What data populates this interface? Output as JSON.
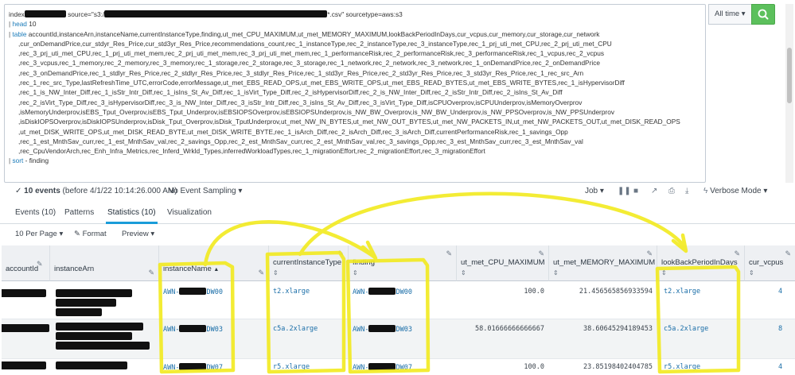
{
  "search": {
    "line1_prefix": "index",
    "line1_source": "source=\"s3:/",
    "line1_suffix": "*.csv\"",
    "line1_sourcetype": "sourcetype=aws:s3",
    "pipe": "|",
    "head_cmd": "head",
    "head_arg": "10",
    "table_cmd": "table",
    "table_lines": [
      "accountId,instanceArn,instanceName,currentInstanceType,finding,ut_met_CPU_MAXIMUM,ut_met_MEMORY_MAXIMUM,lookBackPeriodInDays,cur_vcpus,cur_memory,cur_storage,cur_network",
      ",cur_onDemandPrice,cur_stdyr_Res_Price,cur_std3yr_Res_Price,recommendations_count,rec_1_instanceType,rec_2_instanceType,rec_3_instanceType,rec_1_prj_uti_met_CPU,rec_2_prj_uti_met_CPU",
      ",rec_3_prj_uti_met_CPU,rec_1_prj_uti_met_mem,rec_2_prj_uti_met_mem,rec_3_prj_uti_met_mem,rec_1_performanceRisk,rec_2_performanceRisk,rec_3_performanceRisk,rec_1_vcpus,rec_2_vcpus",
      ",rec_3_vcpus,rec_1_memory,rec_2_memory,rec_3_memory,rec_1_storage,rec_2_storage,rec_3_storage,rec_1_network,rec_2_network,rec_3_network,rec_1_onDemandPrice,rec_2_onDemandPrice",
      ",rec_3_onDemandPrice,rec_1_stdlyr_Res_Price,rec_2_stdlyr_Res_Price,rec_3_stdlyr_Res_Price,rec_1_std3yr_Res_Price,rec_2_std3yr_Res_Price,rec_3_std3yr_Res_Price,rec_1_rec_src_Arn",
      ",rec_1_rec_src_Type,lastRefreshTime_UTC,errorCode,errorMessage,ut_met_EBS_READ_OPS,ut_met_EBS_WRITE_OPS,ut_met_EBS_READ_BYTES,ut_met_EBS_WRITE_BYTES,rec_1_isHypervisorDiff",
      ",rec_1_is_NW_Inter_Diff,rec_1_isStr_Intr_Diff,rec_1_isIns_St_Av_Diff,rec_1_isVirt_Type_Diff,rec_2_isHypervisorDiff,rec_2_is_NW_Inter_Diff,rec_2_isStr_Intr_Diff,rec_2_isIns_St_Av_Diff",
      ",rec_2_isVirt_Type_Diff,rec_3_isHypervisorDiff,rec_3_is_NW_Inter_Diff,rec_3_isStr_Intr_Diff,rec_3_isIns_St_Av_Diff,rec_3_isVirt_Type_Diff,isCPUOverprov,isCPUUnderprov,isMemoryOverprov",
      ",isMemoryUnderprov,isEBS_Tput_Overprov,isEBS_Tput_Underprov,isEBSIOPSOverprov,isEBSIOPSUnderprov,is_NW_BW_Overprov,is_NW_BW_Underprov,is_NW_PPSOverprov,is_NW_PPSUnderprov",
      ",isDiskIOPSOverprov,isDiskIOPSUnderprov,isDisk_Tput_Overprov,isDisk_TputUnderprov,ut_met_NW_IN_BYTES,ut_met_NW_OUT_BYTES,ut_met_NW_PACKETS_IN,ut_met_NW_PACKETS_OUT,ut_met_DISK_READ_OPS",
      ",ut_met_DISK_WRITE_OPS,ut_met_DISK_READ_BYTE,ut_met_DISK_WRITE_BYTE,rec_1_isArch_Diff,rec_2_isArch_Diff,rec_3_isArch_Diff,currentPerformanceRisk,rec_1_savings_Opp",
      ",rec_1_est_MnthSav_curr,rec_1_est_MnthSav_val,rec_2_savings_Opp,rec_2_est_MnthSav_curr,rec_2_est_MnthSav_val,rec_3_savings_Opp,rec_3_est_MnthSav_curr,rec_3_est_MnthSav_val",
      ",rec_CpuVendorArch,rec_Enh_Infra_Metrics,rec_Inferd_Wrkld_Types,inferredWorkloadTypes,rec_1_migrationEffort,rec_2_migrationEffort,rec_3_migrationEffort"
    ],
    "sort_cmd": "sort",
    "sort_arg": "- finding",
    "time_range": "All time ▾",
    "search_icon": "search-icon"
  },
  "status": {
    "count": "10 events",
    "detail": "(before 4/1/22 10:14:26.000 AM)",
    "sampling": "No Event Sampling ▾",
    "job": "Job ▾",
    "verbose": "Verbose Mode ▾",
    "icons": [
      "pause-icon",
      "stop-icon",
      "share-icon",
      "print-icon",
      "export-icon",
      "verbose-icon"
    ]
  },
  "tabs": [
    {
      "label": "Events (10)",
      "active": false
    },
    {
      "label": "Patterns",
      "active": false
    },
    {
      "label": "Statistics (10)",
      "active": true
    },
    {
      "label": "Visualization",
      "active": false
    }
  ],
  "toolbar": {
    "per_page": "10 Per Page ▾",
    "format": "Format",
    "preview": "Preview ▾"
  },
  "columns": [
    {
      "name": "accountId"
    },
    {
      "name": "instanceArn"
    },
    {
      "name": "instanceName",
      "sort": "▲"
    },
    {
      "name": "currentInstanceType"
    },
    {
      "name": "finding"
    },
    {
      "name": "ut_met_CPU_MAXIMUM"
    },
    {
      "name": "ut_met_MEMORY_MAXIMUM"
    },
    {
      "name": "lookBackPeriodInDays"
    },
    {
      "name": "cur_vcpus"
    }
  ],
  "rows": [
    {
      "instanceName_pre": "AWN-",
      "instanceName_post": "DW00",
      "type": "t2.xlarge",
      "finding_pre": "AWN-",
      "finding_post": "DW00",
      "cpu": "100.0",
      "mem": "21.456565856933594",
      "lookback": "t2.xlarge",
      "vcpus": "4"
    },
    {
      "instanceName_pre": "AWN-",
      "instanceName_post": "DW03",
      "type": "c5a.2xlarge",
      "finding_pre": "AWN-",
      "finding_post": "DW03",
      "cpu": "58.01666666666667",
      "mem": "38.60645294189453",
      "lookback": "c5a.2xlarge",
      "vcpus": "8"
    },
    {
      "instanceName_pre": "AWN-",
      "instanceName_post": "DW07",
      "type": "r5.xlarge",
      "finding_pre": "AWN-",
      "finding_post": "DW07",
      "cpu": "100.0",
      "mem": "23.85198402404785",
      "lookback": "r5.xlarge",
      "vcpus": "4"
    }
  ],
  "colors": {
    "accent": "#1a9cd9",
    "search_button": "#5cc05c",
    "annotation": "#f2ea1f",
    "redaction": "#111111"
  }
}
